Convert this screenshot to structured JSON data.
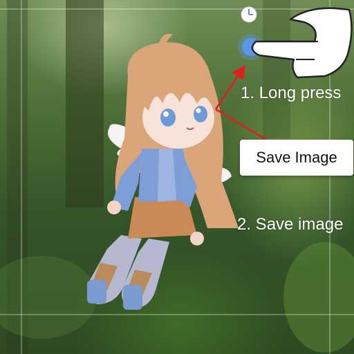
{
  "instructions": {
    "step1": "1. Long press",
    "step2": "2. Save image"
  },
  "context_menu": {
    "save_image_label": "Save Image"
  },
  "icons": {
    "hand": "hand-pointer-icon",
    "press_indicator": "press-circle-icon",
    "clock": "clock-icon"
  },
  "colors": {
    "arrow": "#e0201e",
    "popup_bg": "#ffffff",
    "press_circle": "#5a96e6"
  }
}
